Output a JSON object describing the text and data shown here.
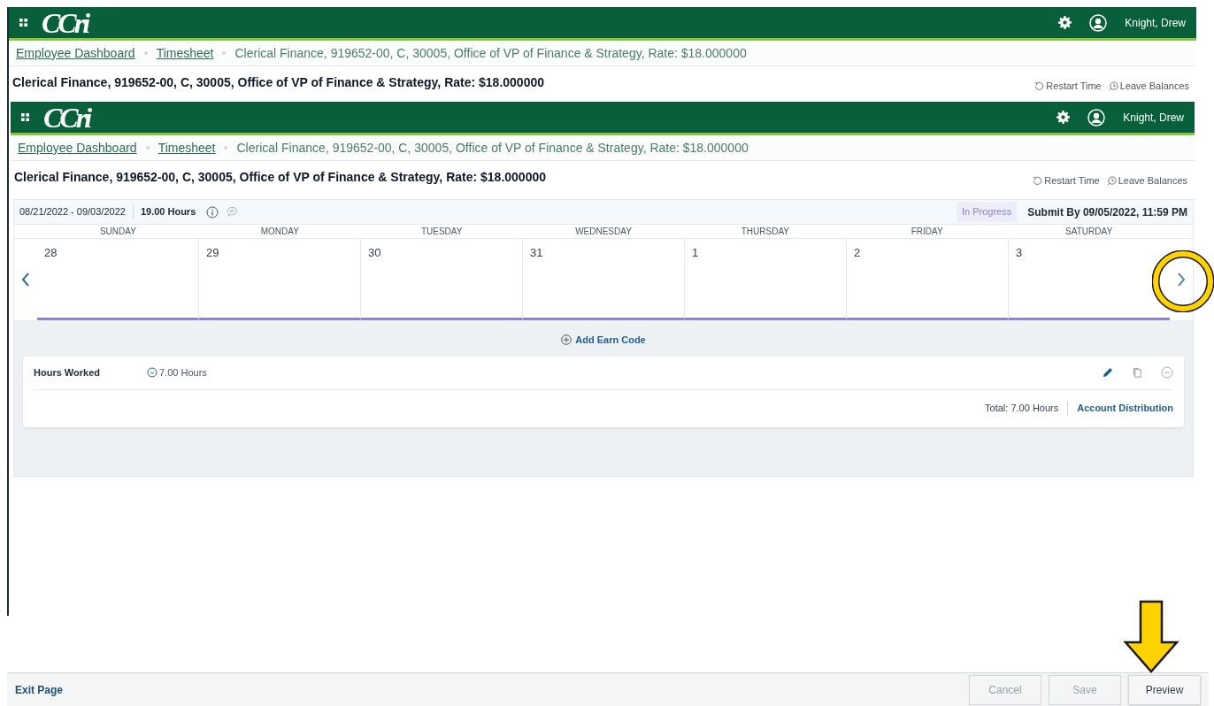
{
  "screens": [
    {
      "header": {
        "logo": "CCri",
        "user": "Knight, Drew"
      },
      "breadcrumbs": [
        {
          "label": "Employee Dashboard",
          "kind": "link"
        },
        {
          "label": "Timesheet",
          "kind": "link"
        },
        {
          "label": "Clerical Finance, 919652-00, C, 30005, Office of VP of Finance & Strategy, Rate: $18.000000",
          "kind": "current"
        }
      ],
      "title": "Clerical Finance, 919652-00, C, 30005, Office of VP of Finance & Strategy, Rate: $18.000000",
      "actions": [
        {
          "label": "Restart Time",
          "kind": "restart"
        },
        {
          "label": "Leave Balances",
          "kind": "balances"
        }
      ]
    },
    {
      "header": {
        "logo": "CCri",
        "user": "Knight, Drew"
      },
      "breadcrumbs": [
        {
          "label": "Employee Dashboard",
          "kind": "link"
        },
        {
          "label": "Timesheet",
          "kind": "link"
        },
        {
          "label": "Clerical Finance, 919652-00, C, 30005, Office of VP of Finance & Strategy, Rate: $18.000000",
          "kind": "current"
        }
      ],
      "title": "Clerical Finance, 919652-00, C, 30005, Office of VP of Finance & Strategy, Rate: $18.000000",
      "actions": [
        {
          "label": "Restart Time",
          "kind": "restart"
        },
        {
          "label": "Leave Balances",
          "kind": "balances"
        }
      ]
    }
  ],
  "timesheet": {
    "period": "08/21/2022 - 09/03/2022",
    "hours": "19.00 Hours",
    "status": "In Progress",
    "submit_by": "Submit By 09/05/2022, 11:59 PM",
    "days": [
      {
        "name": "SUNDAY",
        "date": "28"
      },
      {
        "name": "MONDAY",
        "date": "29"
      },
      {
        "name": "TUESDAY",
        "date": "30"
      },
      {
        "name": "WEDNESDAY",
        "date": "31"
      },
      {
        "name": "THURSDAY",
        "date": "1"
      },
      {
        "name": "FRIDAY",
        "date": "2"
      },
      {
        "name": "SATURDAY",
        "date": "3"
      }
    ],
    "add_earn_code": "Add Earn Code",
    "earn_codes": [
      {
        "name": "Hours Worked",
        "hours": "7.00 Hours",
        "total": "Total: 7.00 Hours",
        "link": "Account Distribution"
      }
    ]
  },
  "footer": {
    "exit": "Exit Page",
    "buttons": [
      {
        "label": "Cancel",
        "disabled": true
      },
      {
        "label": "Save",
        "disabled": true
      },
      {
        "label": "Preview",
        "disabled": false
      }
    ]
  },
  "annotations": {
    "circle_on_next": true,
    "arrow_on_preview": true
  }
}
